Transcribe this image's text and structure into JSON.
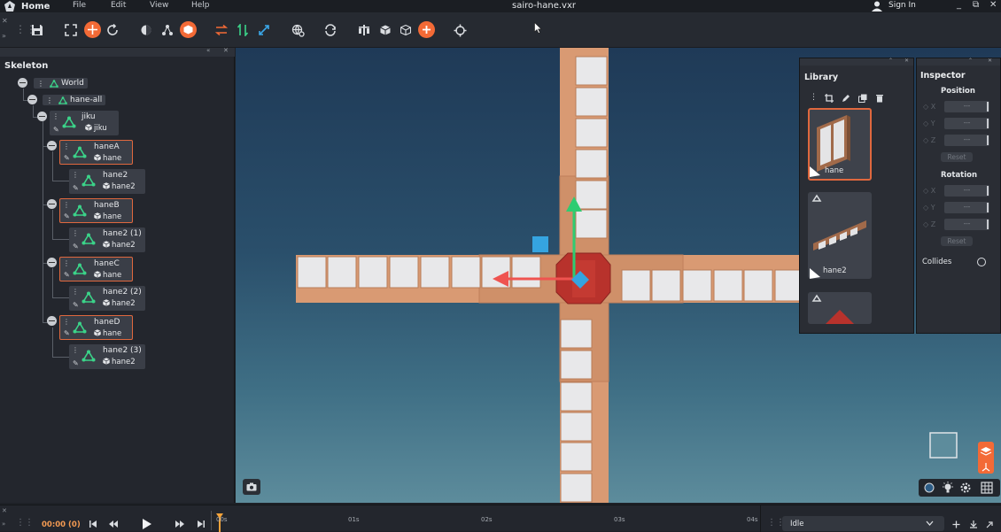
{
  "titlebar": {
    "home": "Home",
    "menu": [
      "File",
      "Edit",
      "View",
      "Help"
    ],
    "title": "sairo-hane.vxr",
    "sign_in": "Sign In",
    "window_buttons": [
      "_",
      "⧉",
      "✕"
    ]
  },
  "skeleton": {
    "title": "Skeleton",
    "nodes": [
      {
        "name": "World"
      },
      {
        "name": "hane-all"
      },
      {
        "name": "jiku",
        "mesh": "jiku"
      },
      {
        "name": "haneA",
        "mesh": "hane"
      },
      {
        "name": "hane2",
        "mesh": "hane2"
      },
      {
        "name": "haneB",
        "mesh": "hane"
      },
      {
        "name": "hane2 (1)",
        "mesh": "hane2"
      },
      {
        "name": "haneC",
        "mesh": "hane"
      },
      {
        "name": "hane2 (2)",
        "mesh": "hane2"
      },
      {
        "name": "haneD",
        "mesh": "hane"
      },
      {
        "name": "hane2 (3)",
        "mesh": "hane2"
      }
    ]
  },
  "library": {
    "title": "Library",
    "items": [
      {
        "label": "hane"
      },
      {
        "label": "hane2"
      }
    ]
  },
  "inspector": {
    "title": "Inspector",
    "position_label": "Position",
    "rotation_label": "Rotation",
    "axes": [
      "X",
      "Y",
      "Z"
    ],
    "field_value": "---",
    "reset_label": "Reset",
    "collides_label": "Collides"
  },
  "timeline": {
    "time": "00:00 (0)",
    "ticks": [
      "00s",
      "01s",
      "02s",
      "03s",
      "04s"
    ],
    "animation": "Idle"
  },
  "colors": {
    "accent": "#f36a36",
    "node_green": "#3bd389",
    "selection": "#e0683e"
  }
}
